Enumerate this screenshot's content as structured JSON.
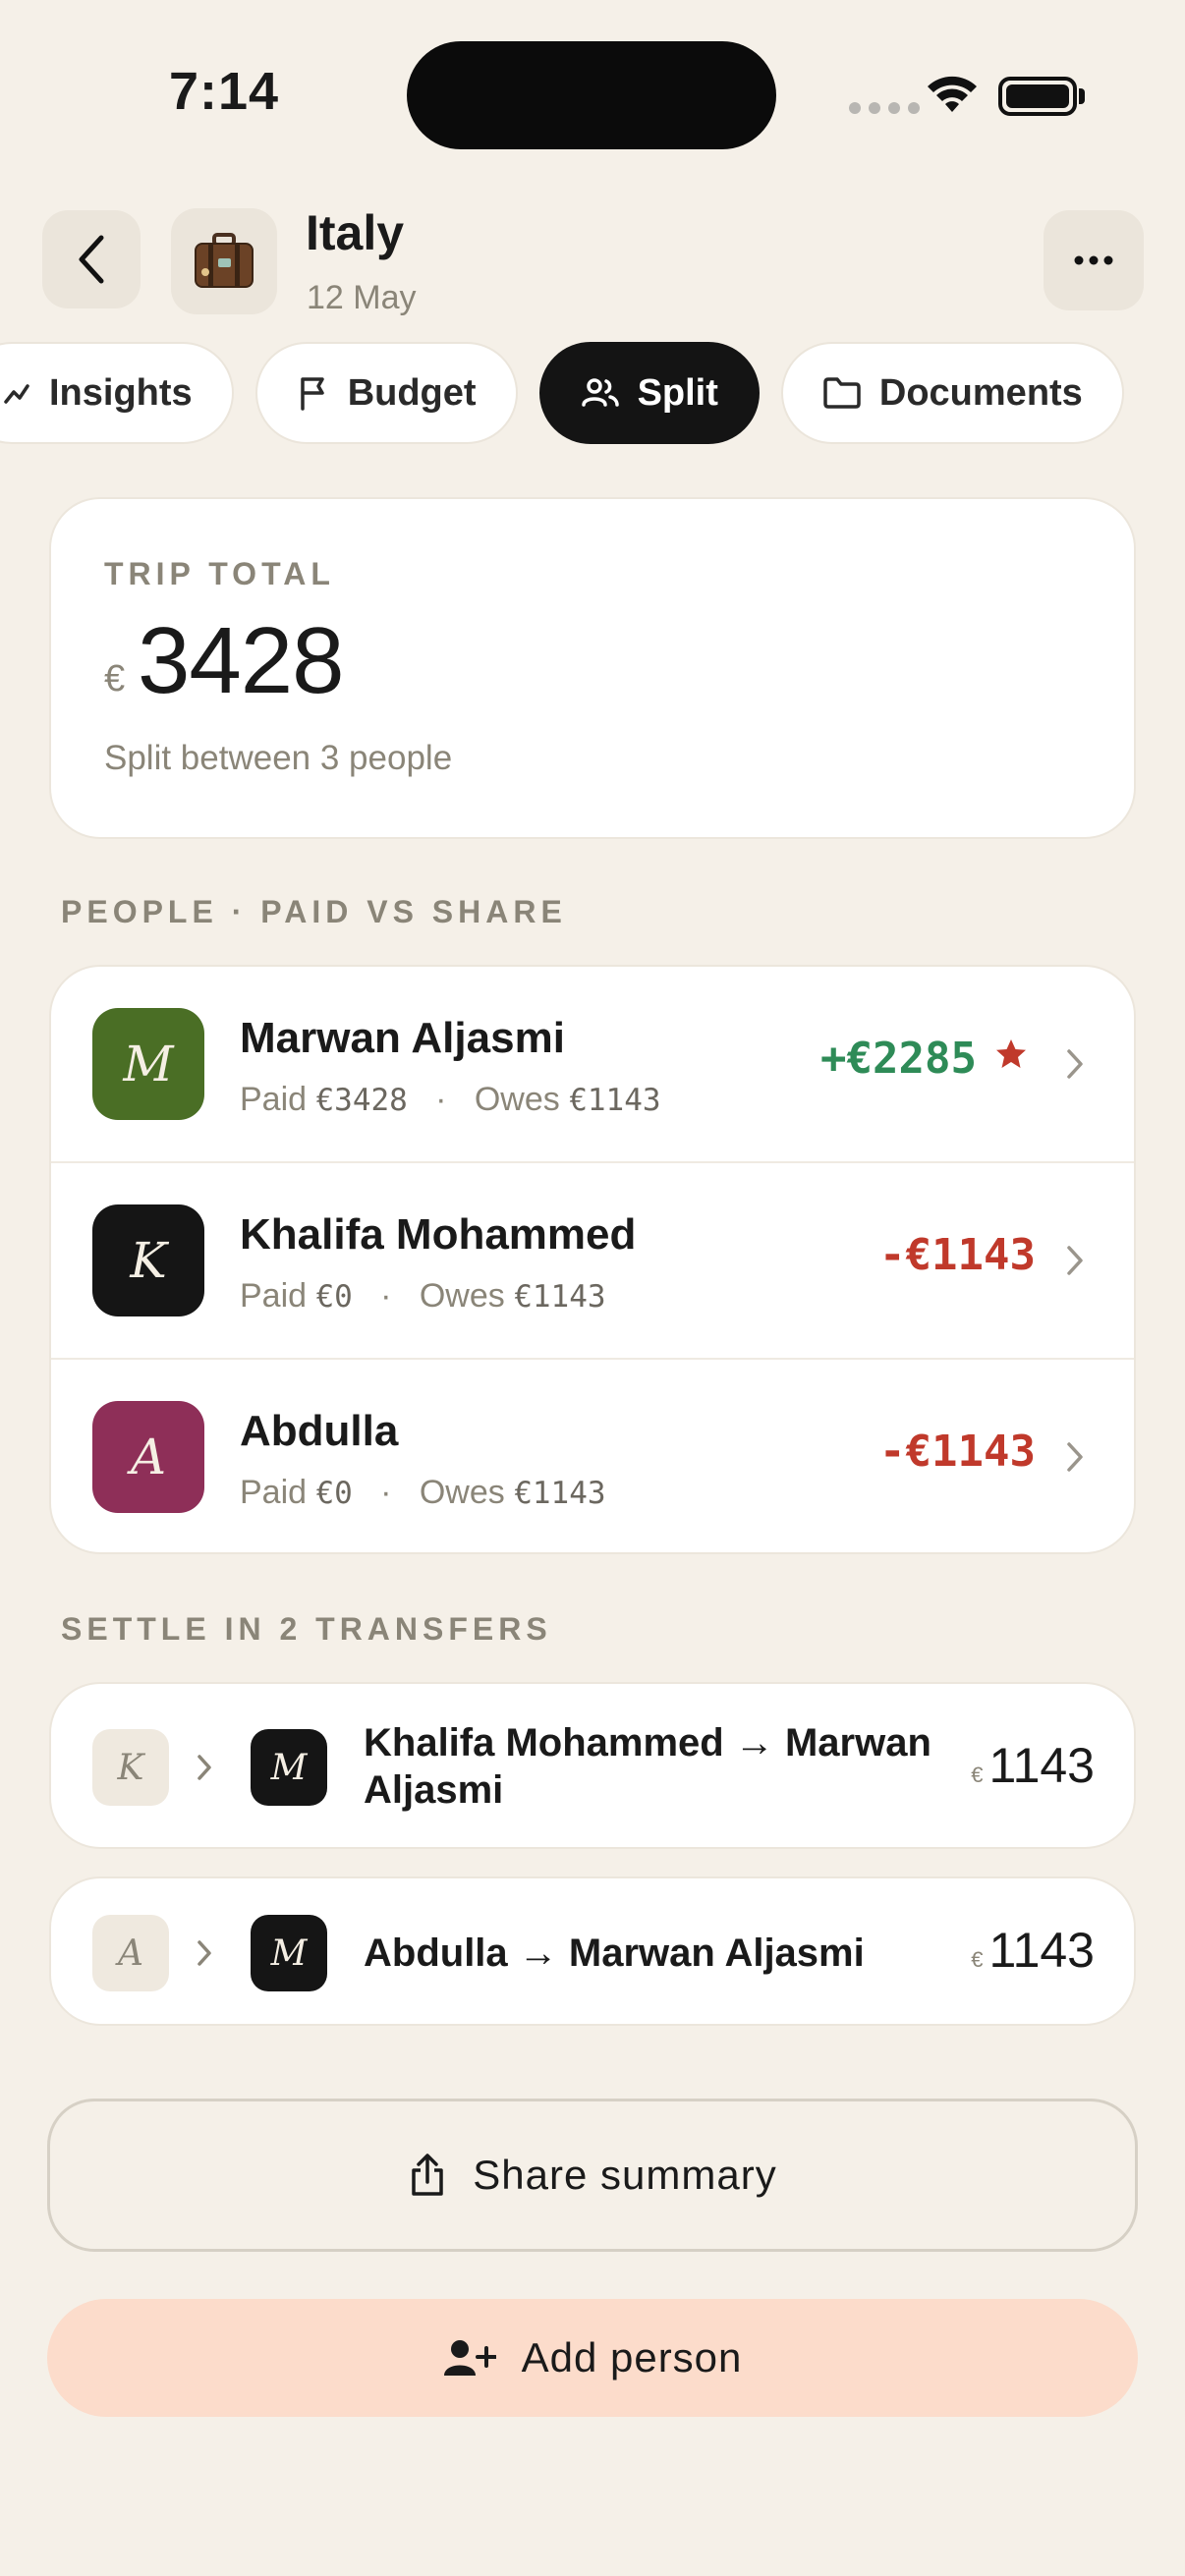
{
  "status_bar": {
    "time": "7:14"
  },
  "header": {
    "title": "Italy",
    "date": "12 May"
  },
  "tabs": [
    {
      "label": "Insights",
      "icon": "chart-icon"
    },
    {
      "label": "Budget",
      "icon": "flag-icon"
    },
    {
      "label": "Split",
      "icon": "people-icon",
      "active": true
    },
    {
      "label": "Documents",
      "icon": "folder-icon"
    }
  ],
  "total": {
    "label": "TRIP TOTAL",
    "currency": "€",
    "value": "3428",
    "subtitle": "Split between 3 people"
  },
  "people_section": {
    "label": "PEOPLE · PAID VS SHARE"
  },
  "people": [
    {
      "initial": "M",
      "name": "Marwan Aljasmi",
      "paid_label": "Paid",
      "paid": "€3428",
      "owes_label": "Owes",
      "owes": "€1143",
      "balance": "+€2285",
      "color": "#4a6e25"
    },
    {
      "initial": "K",
      "name": "Khalifa Mohammed",
      "paid_label": "Paid",
      "paid": "€0",
      "owes_label": "Owes",
      "owes": "€1143",
      "balance": "-€1143",
      "color": "#151515"
    },
    {
      "initial": "A",
      "name": "Abdulla",
      "paid_label": "Paid",
      "paid": "€0",
      "owes_label": "Owes",
      "owes": "€1143",
      "balance": "-€1143",
      "color": "#8e2f58"
    }
  ],
  "settle_section": {
    "label": "SETTLE IN 2 TRANSFERS"
  },
  "transfers": [
    {
      "from_initial": "K",
      "to_initial": "M",
      "text": "Khalifa Mohammed → Marwan Aljasmi",
      "currency": "€",
      "amount": "1143"
    },
    {
      "from_initial": "A",
      "to_initial": "M",
      "text": "Abdulla → Marwan Aljasmi",
      "currency": "€",
      "amount": "1143"
    }
  ],
  "actions": {
    "share_label": "Share summary",
    "add_label": "Add person"
  },
  "colors": {
    "background": "#f5f0e8",
    "positive": "#2e8b57",
    "negative": "#c0392b",
    "accent": "#fcdccb"
  }
}
